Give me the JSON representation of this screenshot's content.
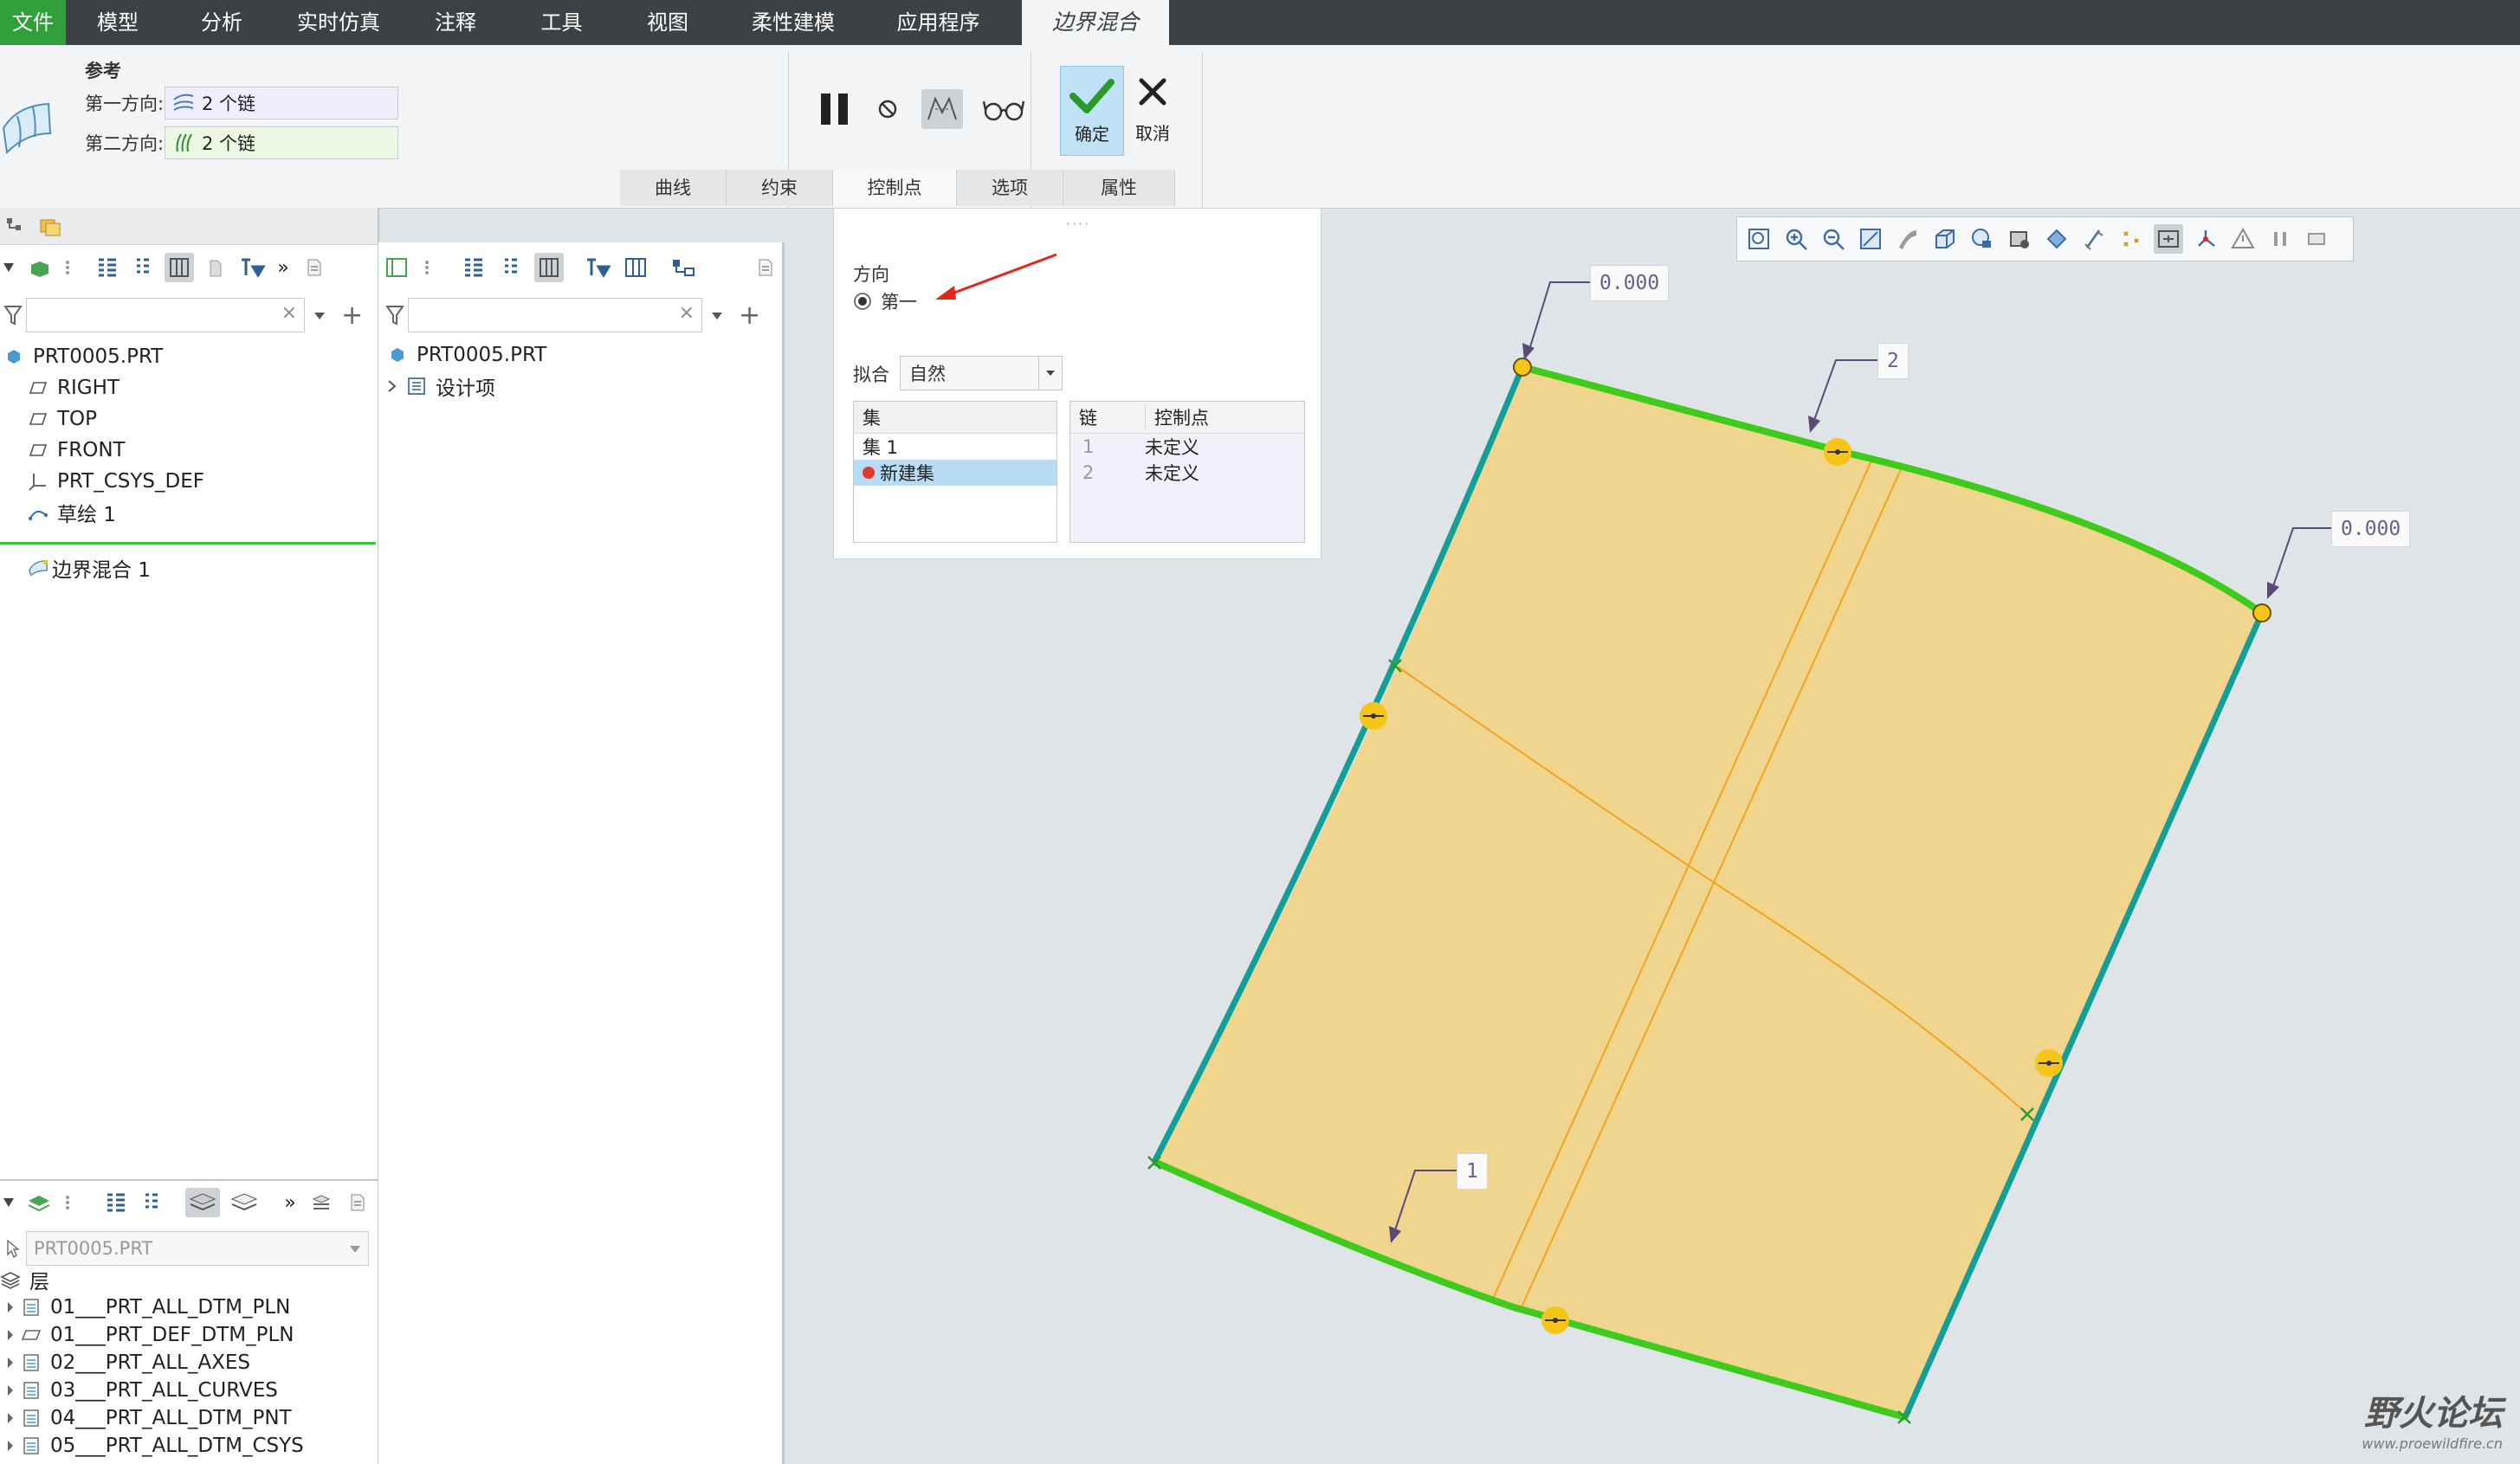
{
  "menubar": {
    "file": "文件",
    "tabs": [
      "模型",
      "分析",
      "实时仿真",
      "注释",
      "工具",
      "视图",
      "柔性建模",
      "应用程序"
    ],
    "active_tab": "边界混合"
  },
  "ribbon": {
    "reference_title": "参考",
    "first_dir_label": "第一方向:",
    "first_dir_value": "2 个链",
    "second_dir_label": "第二方向:",
    "second_dir_value": "2 个链",
    "confirm": "确定",
    "cancel": "取消",
    "subtabs": [
      "曲线",
      "约束",
      "控制点",
      "选项",
      "属性"
    ]
  },
  "model_tree": {
    "root": "PRT0005.PRT",
    "items": [
      "RIGHT",
      "TOP",
      "FRONT",
      "PRT_CSYS_DEF",
      "草绘 1"
    ],
    "insert_item": "边界混合 1"
  },
  "design_tree": {
    "root": "PRT0005.PRT",
    "items": [
      "设计项"
    ]
  },
  "layers": {
    "select_value": "PRT0005.PRT",
    "header": "层",
    "items": [
      "01___PRT_ALL_DTM_PLN",
      "01___PRT_DEF_DTM_PLN",
      "02___PRT_ALL_AXES",
      "03___PRT_ALL_CURVES",
      "04___PRT_ALL_DTM_PNT",
      "05___PRT_ALL_DTM_CSYS"
    ]
  },
  "control_dialog": {
    "direction_label": "方向",
    "direction_option": "第一",
    "fit_label": "拟合",
    "fit_value": "自然",
    "sets_header": "集",
    "sets": [
      "集 1",
      "新建集"
    ],
    "chain_header": "链",
    "points_header": "控制点",
    "chains": [
      {
        "index": "1",
        "value": "未定义"
      },
      {
        "index": "2",
        "value": "未定义"
      }
    ]
  },
  "annotations": {
    "top_left_value": "0.000",
    "top_chain": "2",
    "right_value": "0.000",
    "bottom_chain": "1"
  },
  "watermark": {
    "brand": "野火论坛",
    "url": "www.proewildfire.cn"
  },
  "colors": {
    "accent_green": "#2fa03a",
    "surface_fill": "#f0d58e",
    "chain_green": "#3ecb1c",
    "chain_teal": "#139f98",
    "point_yellow": "#f5c518",
    "arrow_red": "#e8251d"
  }
}
